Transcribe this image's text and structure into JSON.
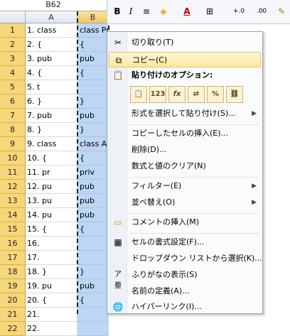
{
  "namebox": "B62",
  "columns": [
    "A",
    "B"
  ],
  "rows": [
    {
      "num": "1",
      "a": "1. class",
      "b": "class Progr"
    },
    {
      "num": "2",
      "a": "2. {",
      "b": "{"
    },
    {
      "num": "3",
      "a": "3.      pub",
      "b": "    pub"
    },
    {
      "num": "4",
      "a": "4.      {",
      "b": "    {"
    },
    {
      "num": "5",
      "a": "5.          t",
      "b": ""
    },
    {
      "num": "6",
      "a": "6.      }",
      "b": "    }"
    },
    {
      "num": "7",
      "a": "7.      pub",
      "b": "    pub"
    },
    {
      "num": "8",
      "a": "8. }",
      "b": "}"
    },
    {
      "num": "9",
      "a": "9. class",
      "b": "class A"
    },
    {
      "num": "10",
      "a": "10. {",
      "b": "{"
    },
    {
      "num": "11",
      "a": "11.      pr",
      "b": "    priv"
    },
    {
      "num": "12",
      "a": "12.      pu",
      "b": "    pub"
    },
    {
      "num": "13",
      "a": "13.      pu",
      "b": "    pub"
    },
    {
      "num": "14",
      "a": "14.      pu",
      "b": "    pub"
    },
    {
      "num": "15",
      "a": "15.      {",
      "b": "    {"
    },
    {
      "num": "16",
      "a": "16.",
      "b": ""
    },
    {
      "num": "17",
      "a": "17.",
      "b": ""
    },
    {
      "num": "18",
      "a": "18.      }",
      "b": "    }"
    },
    {
      "num": "19",
      "a": "19.      pu",
      "b": "    pub"
    },
    {
      "num": "20",
      "a": "20.      {",
      "b": "    {"
    },
    {
      "num": "21",
      "a": "21.",
      "b": ""
    },
    {
      "num": "22",
      "a": "22.",
      "b": ""
    }
  ],
  "mini_toolbar": {
    "bold": "B",
    "italic": "I",
    "align": "≡",
    "fill": "◈",
    "font_color": "A",
    "borders": "⊞",
    "dec_inc": "+.0",
    "dec_dec": ".00",
    "painter": "✎"
  },
  "menu": {
    "cut": "切り取り(T)",
    "copy": "コピー(C)",
    "paste_options": "貼り付けのオプション:",
    "paste_icons": [
      "📋",
      "123",
      "fx",
      "⇄",
      "%",
      "⛓"
    ],
    "paste_special": "形式を選択して貼り付け(S)...",
    "insert_copied": "コピーしたセルの挿入(E)...",
    "delete": "削除(D)...",
    "clear": "数式と値のクリア(N)",
    "filter": "フィルター(E)",
    "sort": "並べ替え(O)",
    "insert_comment": "コメントの挿入(M)",
    "format_cells": "セルの書式設定(F)...",
    "dropdown_pick": "ドロップダウン リストから選択(K)...",
    "phonetic": "ふりがなの表示(S)",
    "define_name": "名前の定義(A)...",
    "hyperlink": "ハイパーリンク(I)...",
    "submenu_arrow": "▶"
  }
}
